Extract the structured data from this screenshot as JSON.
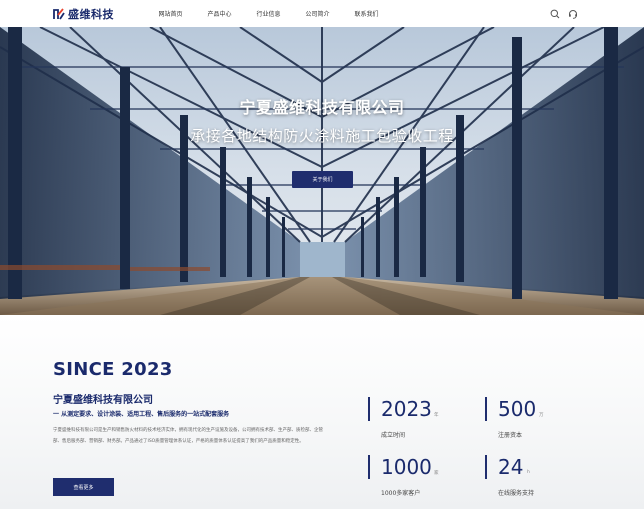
{
  "header": {
    "logo_text": "盛维科技",
    "nav": [
      "网站首页",
      "产品中心",
      "行业信息",
      "公司简介",
      "联系我们"
    ],
    "icons": [
      "search-icon",
      "headset-icon"
    ]
  },
  "hero": {
    "title": "宁夏盛维科技有限公司",
    "subtitle": "承接各地结构防火涂料施工包验收工程",
    "button_label": "关于我们"
  },
  "about": {
    "since": "SINCE 2023",
    "company": "宁夏盛维科技有限公司",
    "slogan": "一 从测定要求、设计涂装、适用工程、售后服务的一站式配套服务",
    "description": "宁夏盛维科技有限公司是生产和销售防火材料的技术经济实体，拥有现代化的生产设施及设备，公司拥有技术部、生产部、质检部、企管部、售后服务部、营销部、财务部。产品通过了ISO质量管理体系认证，严格的质量体系认证提高了我们的产品质量和稳定性。",
    "more_label": "查看更多",
    "stats": [
      {
        "num": "2023",
        "unit": "年",
        "label": "成立时间"
      },
      {
        "num": "500",
        "unit": "万",
        "label": "注册资本"
      },
      {
        "num": "1000",
        "unit": "家",
        "label": "1000多家客户"
      },
      {
        "num": "24",
        "unit": "h",
        "label": "在线服务支持"
      }
    ]
  },
  "colors": {
    "brand": "#1f2d6e",
    "logo_accent": "#e8432e"
  }
}
